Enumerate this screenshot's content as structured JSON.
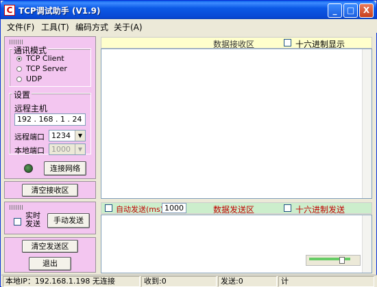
{
  "window": {
    "title": "TCP调试助手 (V1.9)"
  },
  "titlebar_buttons": {
    "minimize": "_",
    "maximize": "□",
    "close": "X"
  },
  "menu": [
    {
      "label": "文件(F)"
    },
    {
      "label": "工具(T)"
    },
    {
      "label": "编码方式"
    },
    {
      "label": "关于(A)"
    }
  ],
  "mode": {
    "title": "通讯模式",
    "options": [
      "TCP Client",
      "TCP Server",
      "UDP"
    ],
    "selected": "TCP Client"
  },
  "settings": {
    "title": "设置",
    "remote_host_label": "远程主机",
    "remote_host_value": "192 . 168 .  1  . 24",
    "remote_port_label": "远程端口",
    "remote_port_value": "1234",
    "local_port_label": "本地端口",
    "local_port_value": "1000",
    "connect_button": "连接网络"
  },
  "clear_recv_button": "清空接收区",
  "realtime_send_label": "实时\n发送",
  "manual_send_button": "手动发送",
  "clear_send_button": "清空发送区",
  "exit_button": "退出",
  "recv": {
    "title": "数据接收区",
    "hex_display_label": "十六进制显示",
    "content": ""
  },
  "send": {
    "auto_send_label": "自动发送(ms)",
    "auto_send_interval": "1000",
    "title": "数据发送区",
    "hex_send_label": "十六进制发送",
    "content": ""
  },
  "status": {
    "local_ip": "本地IP：192.168.1.198 无连接",
    "received": "收到:0",
    "sent": "发送:0",
    "counter": "计"
  },
  "colors": {
    "left_panel": "#f3c6f0",
    "recv_header": "#ffffcc",
    "send_header": "#cceecc",
    "send_header_text": "#c00000"
  }
}
